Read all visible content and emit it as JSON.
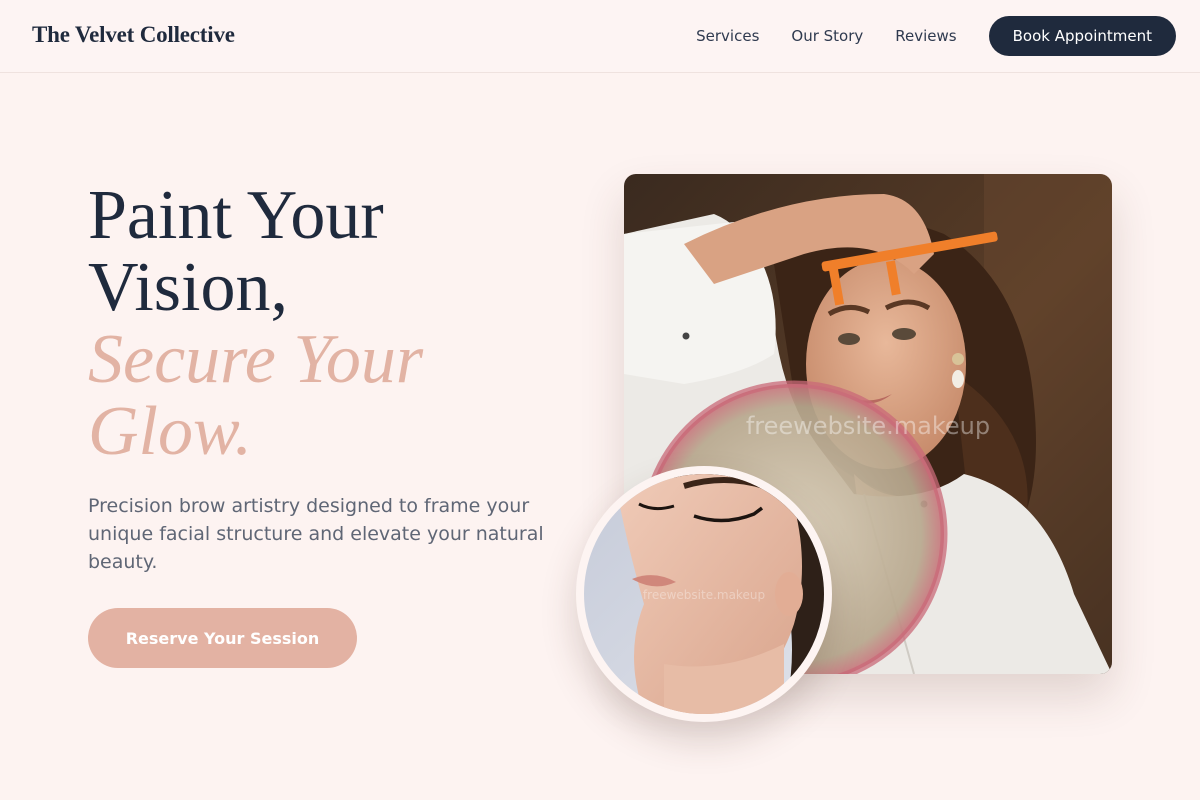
{
  "header": {
    "brand": "The Velvet Collective",
    "nav": {
      "services": "Services",
      "our_story": "Our Story",
      "reviews": "Reviews"
    },
    "cta_label": "Book Appointment"
  },
  "hero": {
    "title_line1": "Paint Your",
    "title_line2": "Vision,",
    "accent_line1": "Secure Your",
    "accent_line2": "Glow.",
    "description": "Precision brow artistry designed to frame your unique facial structure and elevate your natural beauty.",
    "cta_label": "Reserve Your Session"
  },
  "images": {
    "main_watermark": "freewebsite.makeup",
    "circle_watermark": "freewebsite.makeup"
  },
  "colors": {
    "background": "#fdf3f1",
    "navy": "#1f2a3d",
    "accent": "#e2b3a4",
    "body_text": "#5f6675"
  }
}
